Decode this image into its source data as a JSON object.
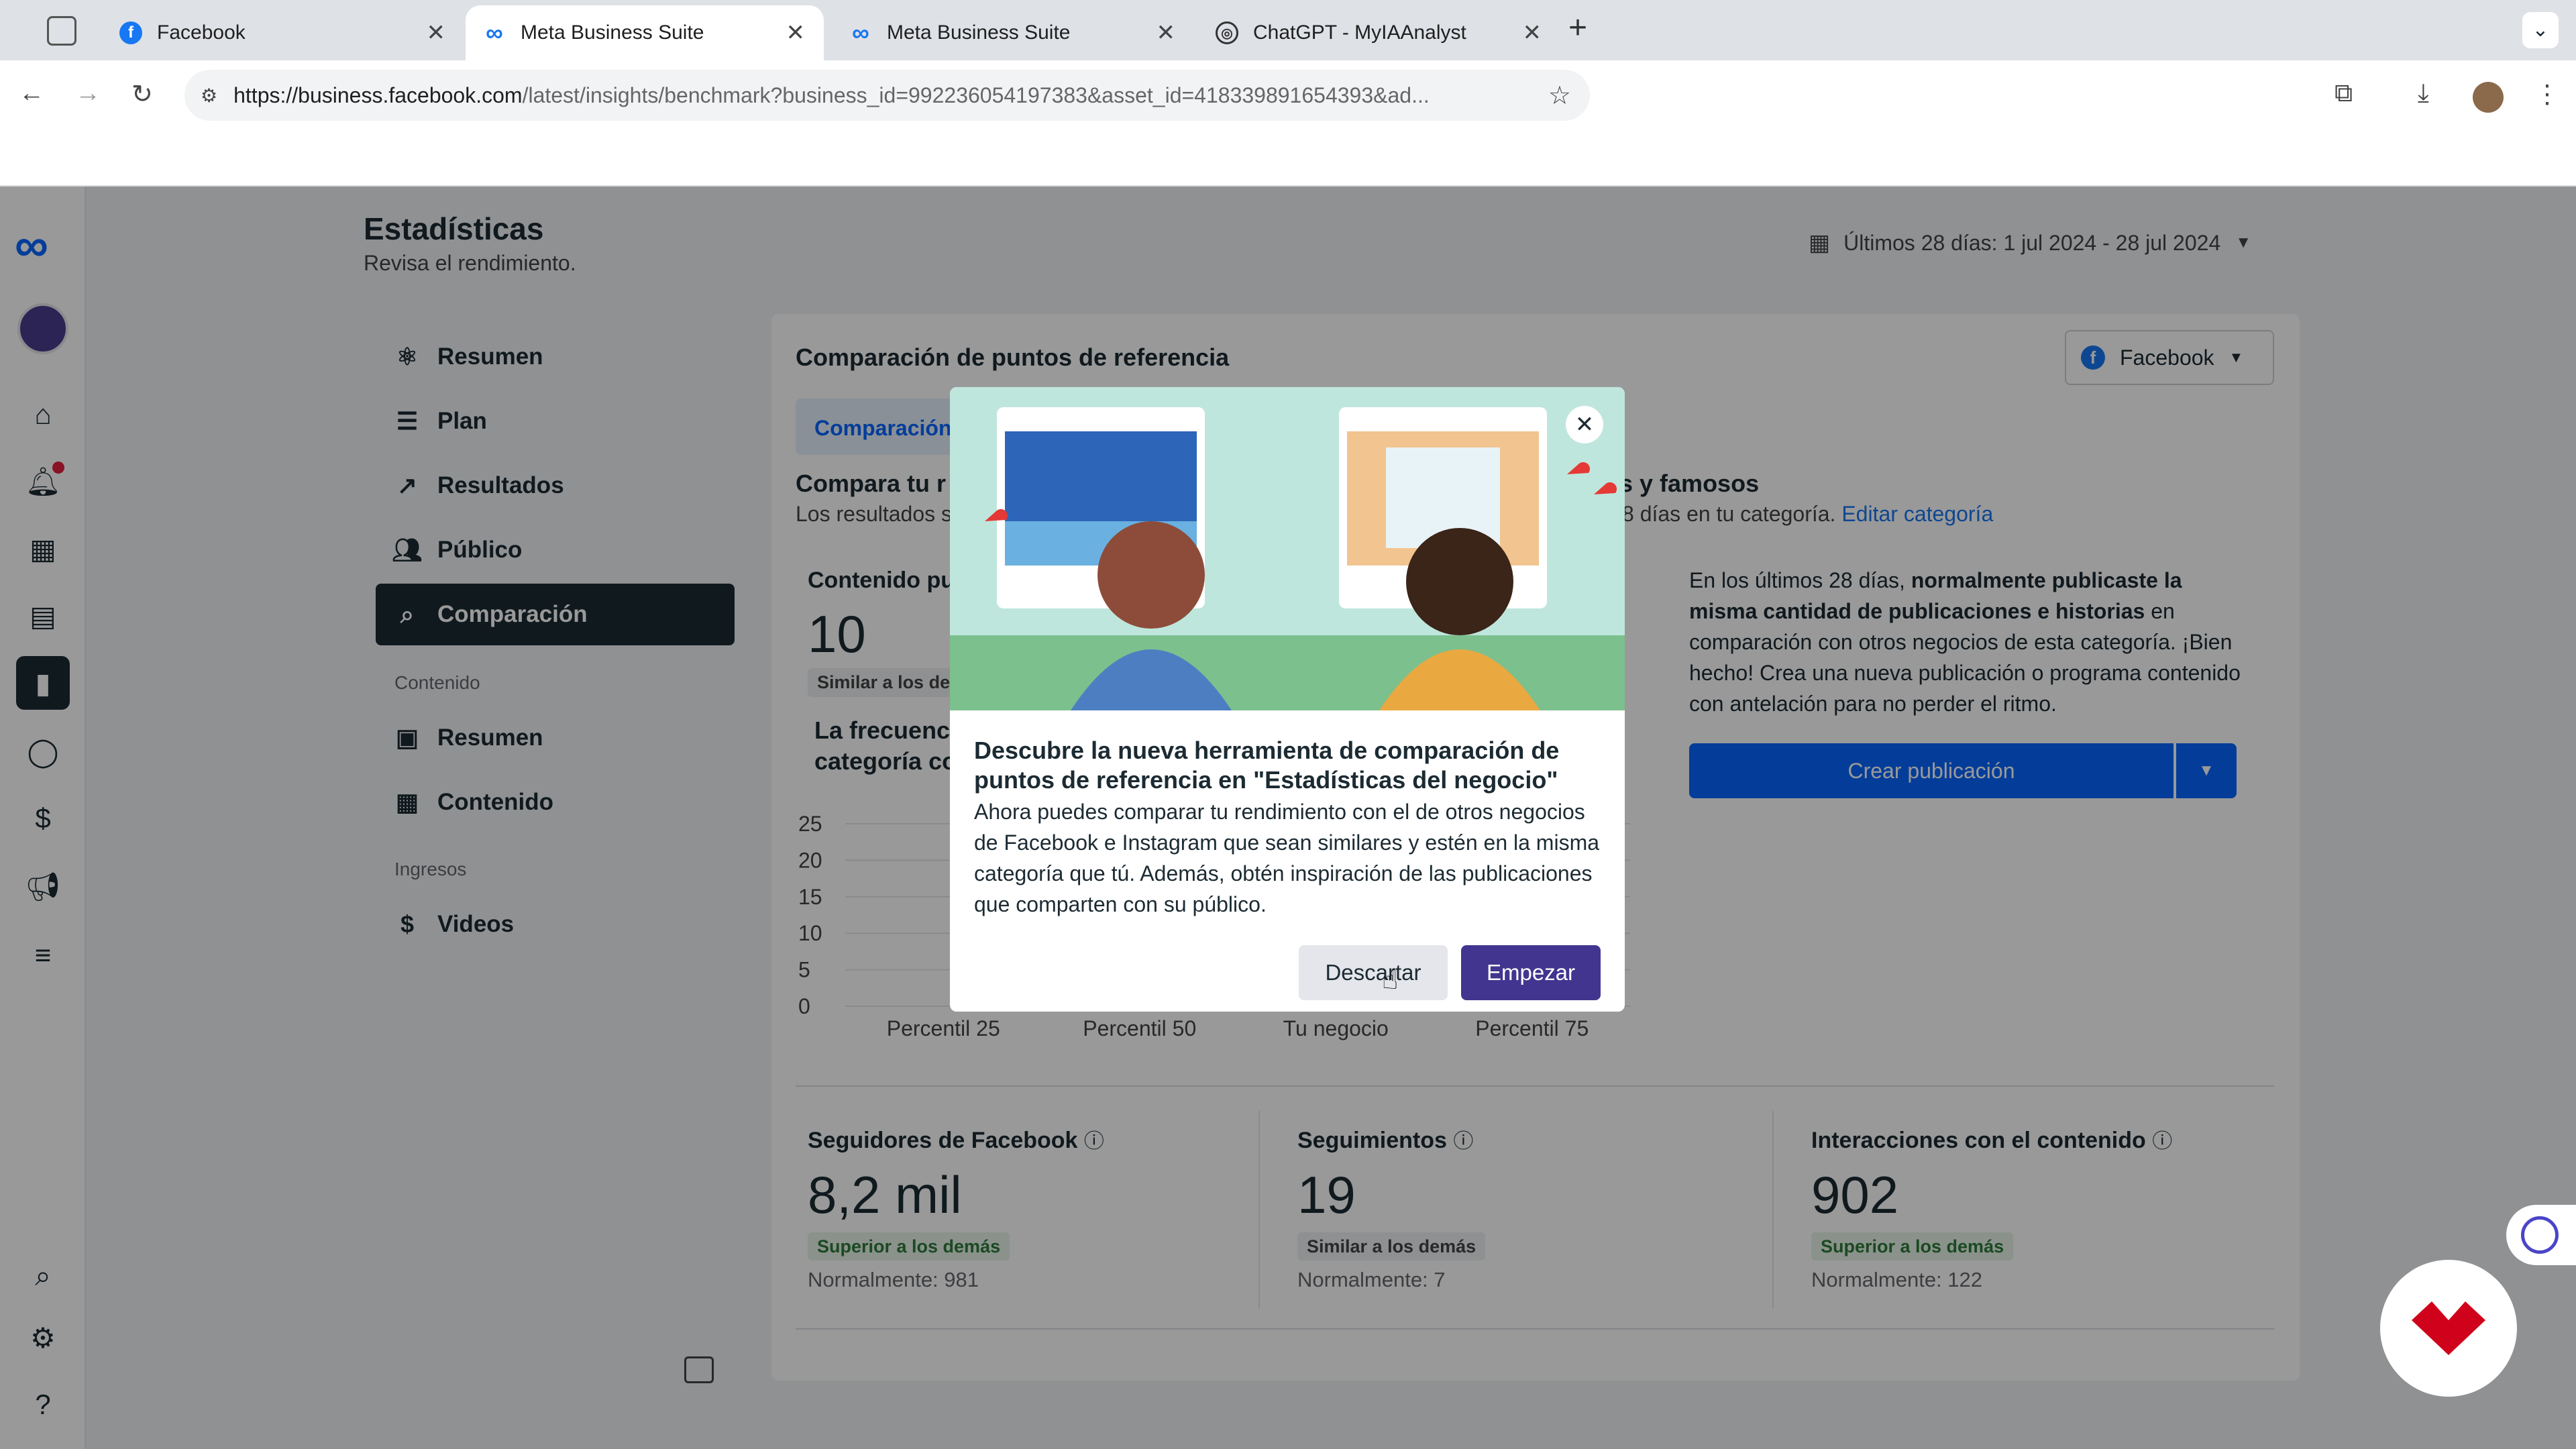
{
  "browser": {
    "tabs": [
      {
        "label": "Facebook"
      },
      {
        "label": "Meta Business Suite"
      },
      {
        "label": "Meta Business Suite"
      },
      {
        "label": "ChatGPT - MyIAAnalyst"
      }
    ],
    "new_tab": "+",
    "url_host": "https://business.facebook.com",
    "url_path": "/latest/insights/benchmark?business_id=992236054197383&asset_id=418339891654393&ad..."
  },
  "header": {
    "title": "Estadísticas",
    "subtitle": "Revisa el rendimiento.",
    "date_range": "Últimos 28 días: 1 jul 2024 - 28 jul 2024"
  },
  "sidebar": {
    "items": [
      {
        "label": "Resumen"
      },
      {
        "label": "Plan"
      },
      {
        "label": "Resultados"
      },
      {
        "label": "Público"
      },
      {
        "label": "Comparación"
      }
    ],
    "section_content": "Contenido",
    "content_items": [
      {
        "label": "Resumen"
      },
      {
        "label": "Contenido"
      }
    ],
    "section_income": "Ingresos",
    "income_items": [
      {
        "label": "Videos"
      }
    ]
  },
  "main": {
    "card_title": "Comparación de puntos de referencia",
    "platform_select": "Facebook",
    "tab_label": "Comparación",
    "compare_heading_start": "Compara tu r",
    "compare_heading_end": "s y famosos",
    "compare_sub_start": "Los resultados s",
    "compare_sub_end": "8 días en tu categoría.",
    "edit_category": "Editar categoría",
    "content_label": "Contenido pu",
    "content_value": "10",
    "content_badge": "Similar a los de",
    "freq_line1": "La frecuenc",
    "freq_line2": "categoría co",
    "summary_pre": "En los últimos 28 días, ",
    "summary_bold": "normalmente publicaste la misma cantidad de publicaciones e historias",
    "summary_post": " en comparación con otros negocios de esta categoría. ¡Bien hecho! Crea una nueva publicación o programa contenido con antelación para no perder el ritmo.",
    "create_button": "Crear publicación"
  },
  "chart_data": {
    "type": "bar",
    "categories": [
      "Percentil 25",
      "Percentil 50",
      "Tu negocio",
      "Percentil 75"
    ],
    "yticks": [
      "25",
      "20",
      "15",
      "10",
      "5",
      "0"
    ],
    "ylim": [
      0,
      25
    ]
  },
  "stats": [
    {
      "title": "Seguidores de Facebook",
      "value": "8,2 mil",
      "badge": "Superior a los demás",
      "note": "Normalmente: 981"
    },
    {
      "title": "Seguimientos",
      "value": "19",
      "badge": "Similar a los demás",
      "note": "Normalmente: 7"
    },
    {
      "title": "Interacciones con el contenido",
      "value": "902",
      "badge": "Superior a los demás",
      "note": "Normalmente: 122"
    }
  ],
  "modal": {
    "title": "Descubre la nueva herramienta de comparación de puntos de referencia en \"Estadísticas del negocio\"",
    "body": "Ahora puedes comparar tu rendimiento con el de otros negocios de Facebook e Instagram que sean similares y estén en la misma categoría que tú. Además, obtén inspiración de las publicaciones que comparten con su público.",
    "dismiss": "Descartar",
    "start": "Empezar"
  },
  "colors": {
    "primary_blue": "#1877f2",
    "modal_button": "#42358f",
    "dark_nav": "#1c2b33",
    "badge_green": "#2d7a3a"
  }
}
